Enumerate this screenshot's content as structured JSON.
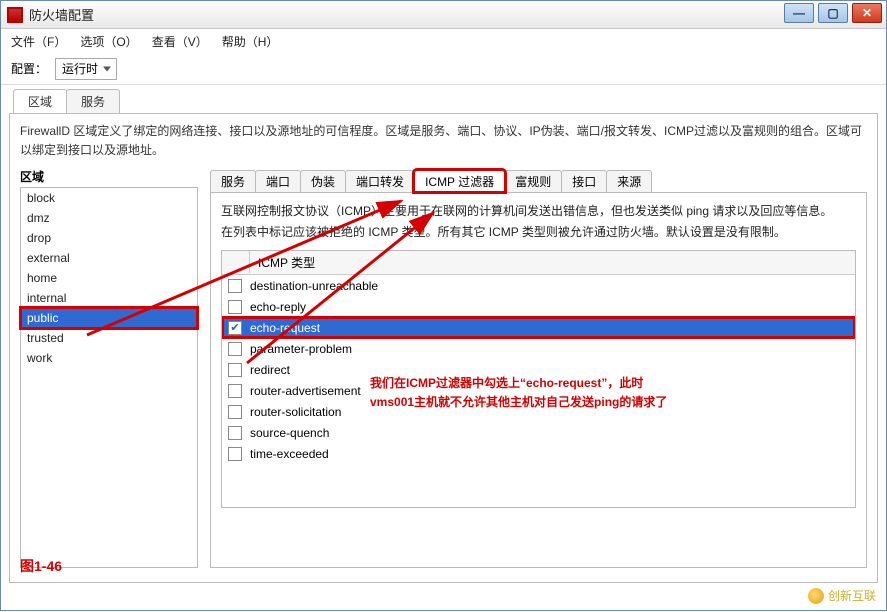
{
  "window": {
    "title": "防火墙配置"
  },
  "menubar": {
    "file": "文件（F）",
    "options": "选项（O）",
    "view": "查看（V）",
    "help": "帮助（H）"
  },
  "toolbar": {
    "config_label": "配置：",
    "config_value": "运行时"
  },
  "upper_tabs": {
    "zones": "区域",
    "services": "服务"
  },
  "description": "FirewallD 区域定义了绑定的网络连接、接口以及源地址的可信程度。区域是服务、端口、协议、IP伪装、端口/报文转发、ICMP过滤以及富规则的组合。区域可以绑定到接口以及源地址。",
  "zones": {
    "heading": "区域",
    "items": [
      "block",
      "dmz",
      "drop",
      "external",
      "home",
      "internal",
      "public",
      "trusted",
      "work"
    ],
    "selected": "public"
  },
  "sub_tabs": {
    "items": [
      "服务",
      "端口",
      "伪装",
      "端口转发",
      "ICMP 过滤器",
      "富规则",
      "接口",
      "来源"
    ],
    "active": "ICMP 过滤器"
  },
  "icmp": {
    "line1": "互联网控制报文协议（ICMP）主要用于在联网的计算机间发送出错信息，但也发送类似 ping 请求以及回应等信息。",
    "line2": "在列表中标记应该被拒绝的 ICMP 类型。所有其它 ICMP 类型则被允许通过防火墙。默认设置是没有限制。",
    "col_header": "ICMP 类型",
    "types": [
      "destination-unreachable",
      "echo-reply",
      "echo-request",
      "parameter-problem",
      "redirect",
      "router-advertisement",
      "router-solicitation",
      "source-quench",
      "time-exceeded"
    ],
    "checked": "echo-request"
  },
  "annotation": {
    "line1": "我们在ICMP过滤器中勾选上“echo-request”，此时",
    "line2": "vms001主机就不允许其他主机对自己发送ping的请求了"
  },
  "fig_label": "图1-46",
  "watermark": "创新互联"
}
